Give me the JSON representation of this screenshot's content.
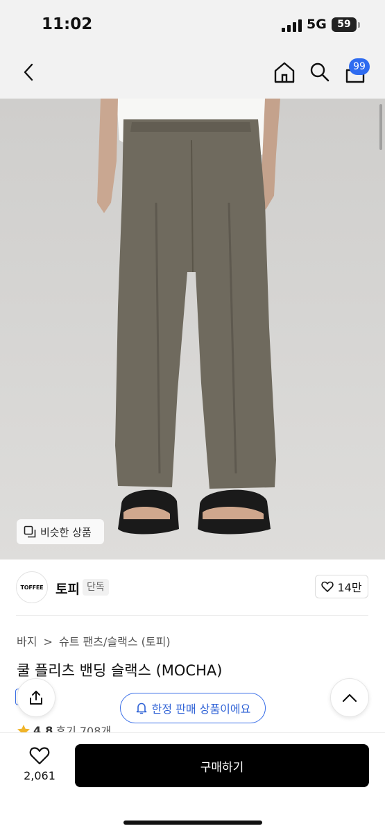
{
  "status_bar": {
    "time": "11:02",
    "network": "5G",
    "battery": "59"
  },
  "nav": {
    "cart_badge": "99",
    "icons": [
      "back-icon",
      "home-icon",
      "search-icon",
      "cart-icon"
    ]
  },
  "image": {
    "similar_button": "비슷한 상품"
  },
  "brand": {
    "logo_text": "TOFFEE",
    "name": "토피",
    "tag": "단독",
    "likes": "14만"
  },
  "product": {
    "breadcrumb_1": "바지",
    "breadcrumb_sep": ">",
    "breadcrumb_2": "슈트 팬츠/슬랙스 (토피)",
    "title": "쿨 플리츠 밴딩 슬랙스 (MOCHA)",
    "rating": "4.8",
    "reviews": "후기 708개"
  },
  "floating": {
    "limited_notice": "한정 판매 상품이에요"
  },
  "bottom_bar": {
    "wish_count": "2,061",
    "buy_label": "구매하기"
  },
  "colors": {
    "accent": "#2f6cf0",
    "buy_button": "#000000",
    "star": "#f0b429"
  }
}
